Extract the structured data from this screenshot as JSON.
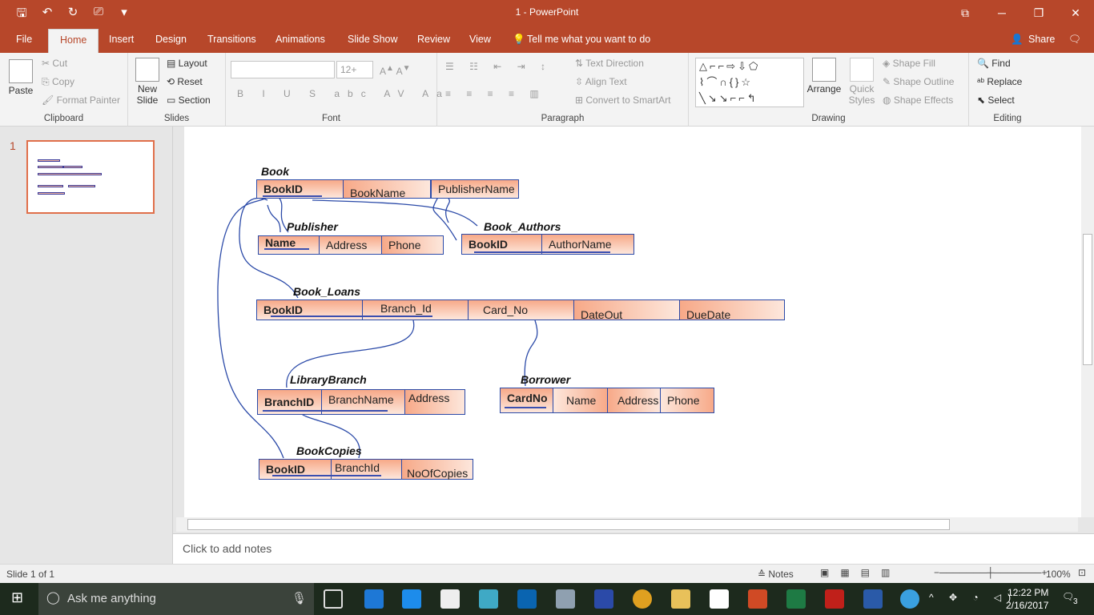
{
  "app": {
    "title": "1  -  PowerPoint"
  },
  "tabs": [
    "File",
    "Home",
    "Insert",
    "Design",
    "Transitions",
    "Animations",
    "Slide Show",
    "Review",
    "View"
  ],
  "tell_me": "Tell me what you want to do",
  "share": "Share",
  "clipboard": {
    "paste": "Paste",
    "cut": "Cut",
    "copy": "Copy",
    "format_painter": "Format Painter",
    "label": "Clipboard"
  },
  "slides_group": {
    "new_slide": "New Slide",
    "layout": "Layout",
    "reset": "Reset",
    "section": "Section",
    "label": "Slides"
  },
  "font_group": {
    "label": "Font",
    "size": "12+"
  },
  "paragraph_group": {
    "label": "Paragraph",
    "text_direction": "Text Direction",
    "align_text": "Align Text",
    "convert": "Convert to SmartArt"
  },
  "drawing_group": {
    "label": "Drawing",
    "arrange": "Arrange",
    "quick_styles": "Quick Styles",
    "shape_fill": "Shape Fill",
    "shape_outline": "Shape Outline",
    "shape_effects": "Shape Effects"
  },
  "editing_group": {
    "label": "Editing",
    "find": "Find",
    "replace": "Replace",
    "select": "Select"
  },
  "thumbnail": {
    "number": "1"
  },
  "diagram": {
    "book": {
      "title": "Book",
      "cols": [
        "BookID",
        "BookName",
        "PublisherName"
      ]
    },
    "publisher": {
      "title": "Publisher",
      "cols": [
        "Name",
        "Address",
        "Phone"
      ]
    },
    "book_authors": {
      "title": "Book_Authors",
      "cols": [
        "BookID",
        "AuthorName"
      ]
    },
    "book_loans": {
      "title": "Book_Loans",
      "cols": [
        "BookID",
        "Branch_Id",
        "Card_No",
        "DateOut",
        "DueDate"
      ]
    },
    "library_branch": {
      "title": "LibraryBranch",
      "cols": [
        "BranchID",
        "BranchName",
        "Address"
      ]
    },
    "borrower": {
      "title": "Borrower",
      "cols": [
        "CardNo",
        "Name",
        "Address",
        "Phone"
      ]
    },
    "book_copies": {
      "title": "BookCopies",
      "cols": [
        "BookID",
        "BranchId",
        "NoOfCopies"
      ]
    }
  },
  "notes_placeholder": "Click to add notes",
  "status": {
    "slide": "Slide 1 of 1",
    "notes": "Notes",
    "zoom": "100%"
  },
  "taskbar": {
    "search": "Ask me anything",
    "time": "12:22 PM",
    "date": "2/16/2017",
    "badge": "3"
  },
  "colors": {
    "accent": "#b7472a",
    "entity_fill_from": "#f7a988",
    "entity_fill_to": "#fde7dc",
    "border": "#2b4aa8"
  }
}
